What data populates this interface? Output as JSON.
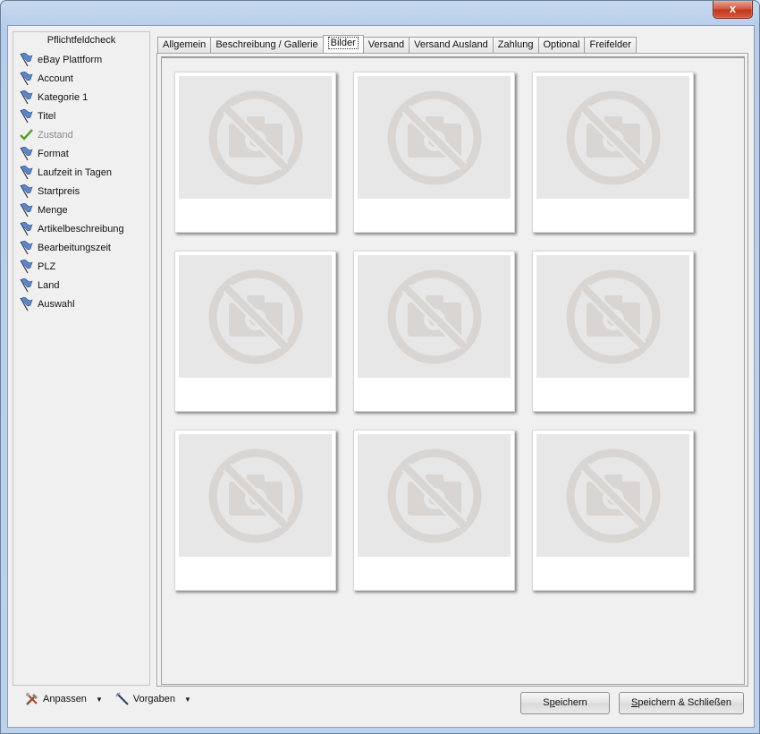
{
  "window": {
    "close_label": "x"
  },
  "checklist": {
    "title": "Pflichtfeldcheck",
    "items": [
      {
        "label": "eBay Plattform",
        "icon": "flag-icon",
        "done": false
      },
      {
        "label": "Account",
        "icon": "flag-icon",
        "done": false
      },
      {
        "label": "Kategorie 1",
        "icon": "flag-icon",
        "done": false
      },
      {
        "label": "Titel",
        "icon": "flag-icon",
        "done": false
      },
      {
        "label": "Zustand",
        "icon": "checkmark-icon",
        "done": true
      },
      {
        "label": "Format",
        "icon": "flag-icon",
        "done": false
      },
      {
        "label": "Laufzeit in Tagen",
        "icon": "flag-icon",
        "done": false
      },
      {
        "label": "Startpreis",
        "icon": "flag-icon",
        "done": false
      },
      {
        "label": "Menge",
        "icon": "flag-icon",
        "done": false
      },
      {
        "label": "Artikelbeschreibung",
        "icon": "flag-icon",
        "done": false
      },
      {
        "label": "Bearbeitungszeit",
        "icon": "flag-icon",
        "done": false
      },
      {
        "label": "PLZ",
        "icon": "flag-icon",
        "done": false
      },
      {
        "label": "Land",
        "icon": "flag-icon",
        "done": false
      },
      {
        "label": "Auswahl",
        "icon": "flag-icon",
        "done": false
      }
    ]
  },
  "tabs": [
    {
      "label": "Allgemein",
      "active": false
    },
    {
      "label": "Beschreibung / Gallerie",
      "active": false
    },
    {
      "label": "Bilder",
      "active": true
    },
    {
      "label": "Versand",
      "active": false
    },
    {
      "label": "Versand Ausland",
      "active": false
    },
    {
      "label": "Zahlung",
      "active": false
    },
    {
      "label": "Optional",
      "active": false
    },
    {
      "label": "Freifelder",
      "active": false
    }
  ],
  "images": [
    {
      "icon": "no-image-icon"
    },
    {
      "icon": "no-image-icon"
    },
    {
      "icon": "no-image-icon"
    },
    {
      "icon": "no-image-icon"
    },
    {
      "icon": "no-image-icon"
    },
    {
      "icon": "no-image-icon"
    },
    {
      "icon": "no-image-icon"
    },
    {
      "icon": "no-image-icon"
    },
    {
      "icon": "no-image-icon"
    }
  ],
  "bottom": {
    "anpassen_label": "Anpassen",
    "vorgaben_label": "Vorgaben",
    "save_label_pre": "S",
    "save_label_mnemonic": "p",
    "save_label_post": "eichern",
    "save_close_label_mnemonic": "S",
    "save_close_label_post": "peichern & Schließen"
  },
  "colors": {
    "flag": "#5b86c8",
    "check": "#5aa02c",
    "placeholder": "#d9d5d2"
  }
}
